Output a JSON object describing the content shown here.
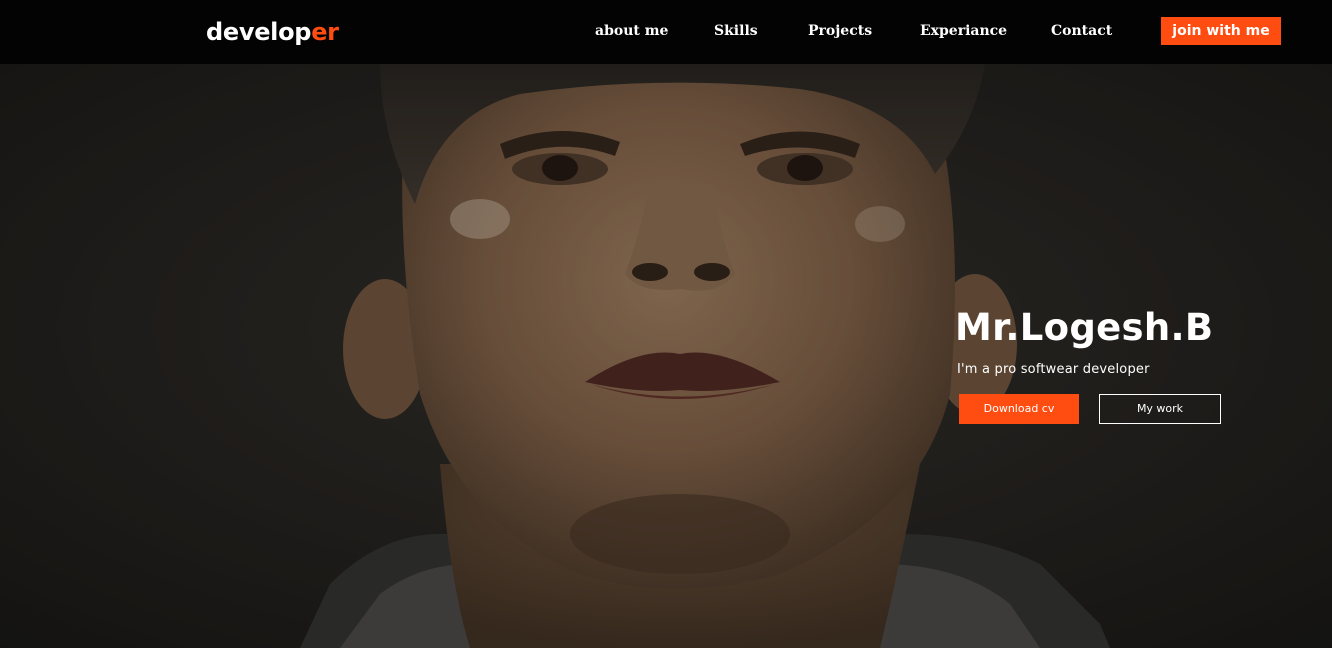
{
  "brand": {
    "logo_main": "develop",
    "logo_accent": "er",
    "accent_color": "#ff4d12"
  },
  "nav": {
    "items": [
      {
        "label": "about me"
      },
      {
        "label": "Skills"
      },
      {
        "label": "Projects"
      },
      {
        "label": "Experiance"
      },
      {
        "label": "Contact"
      }
    ],
    "cta_label": "join with me"
  },
  "hero": {
    "name": "Mr.Logesh.B",
    "tagline": "I'm a pro softwear developer",
    "primary_button": "Download cv",
    "secondary_button": "My work",
    "background_image": "portrait-photo"
  }
}
